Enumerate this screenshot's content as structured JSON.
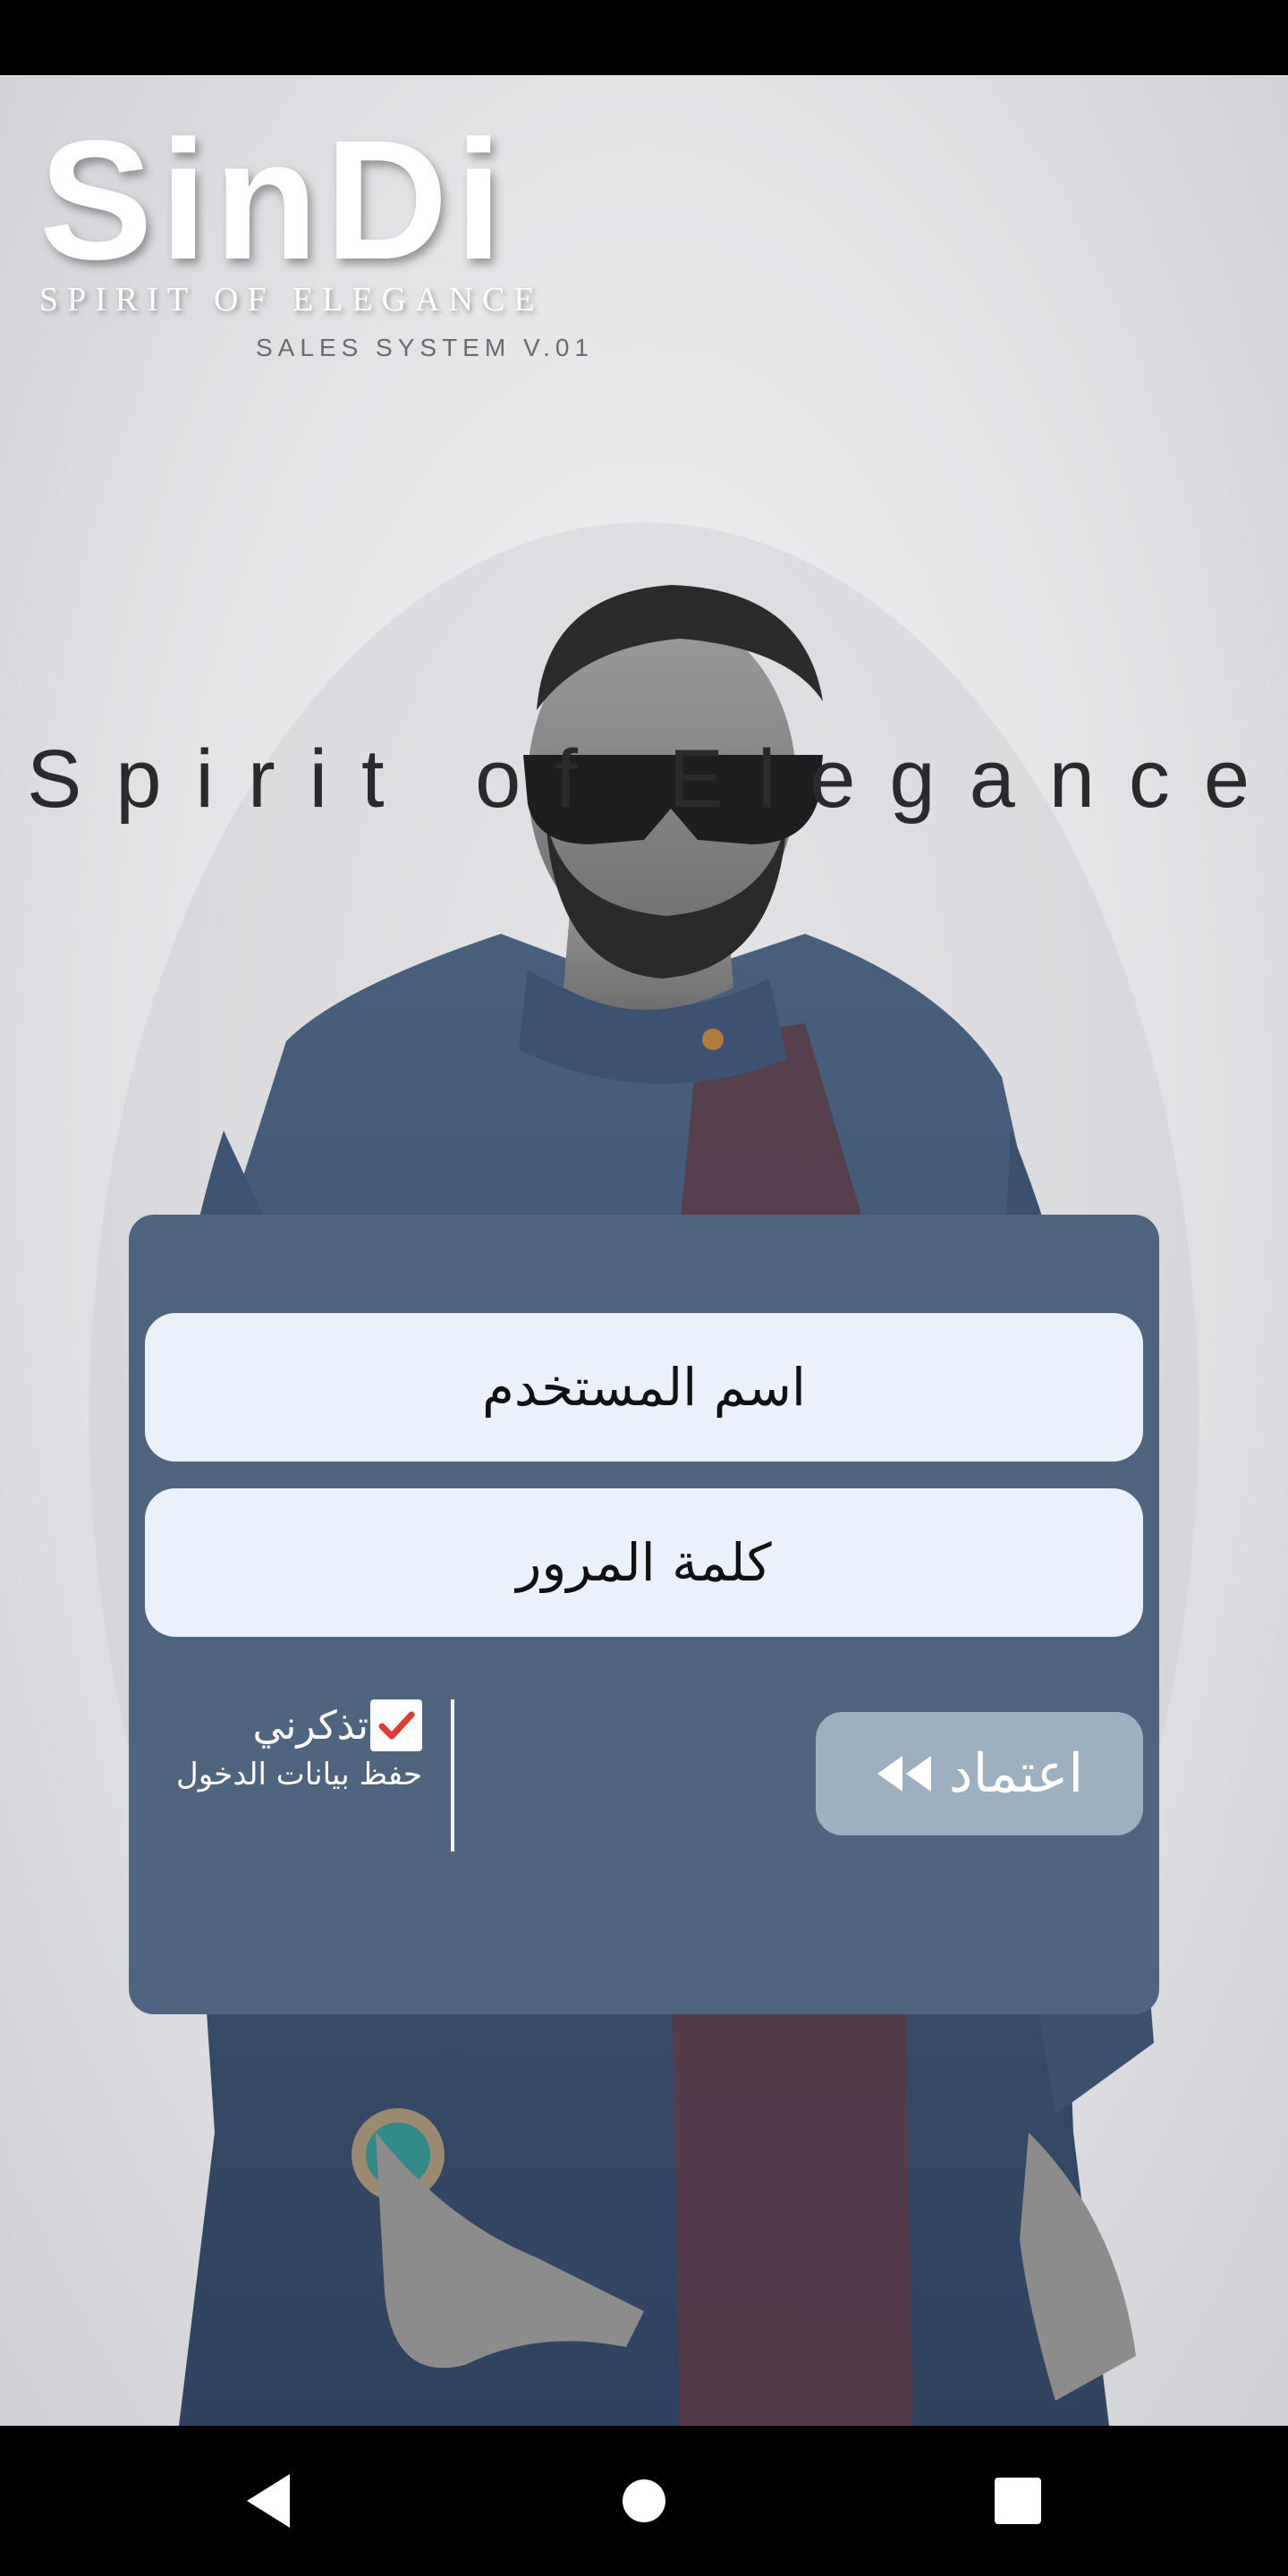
{
  "brand": {
    "logo_text": "SinDi",
    "tagline": "SPIRIT OF ELEGANCE",
    "version": "SALES SYSTEM V.01",
    "slogan": "Spirit of Elegance"
  },
  "login": {
    "username_placeholder": "اسم المستخدم",
    "password_placeholder": "كلمة المرور",
    "remember_label": "تذكرني",
    "remember_sub": "حفظ بيانات الدخول",
    "remember_checked": true,
    "submit_label": "اعتماد",
    "submit_icon": "double-chevron-left-icon"
  },
  "colors": {
    "card": "#4f657f",
    "field": "#ebf1fb",
    "button": "#9cb0c2",
    "check": "#e53935"
  },
  "nav": {
    "back_icon": "back-triangle-icon",
    "home_icon": "home-circle-icon",
    "recents_icon": "recents-square-icon"
  }
}
